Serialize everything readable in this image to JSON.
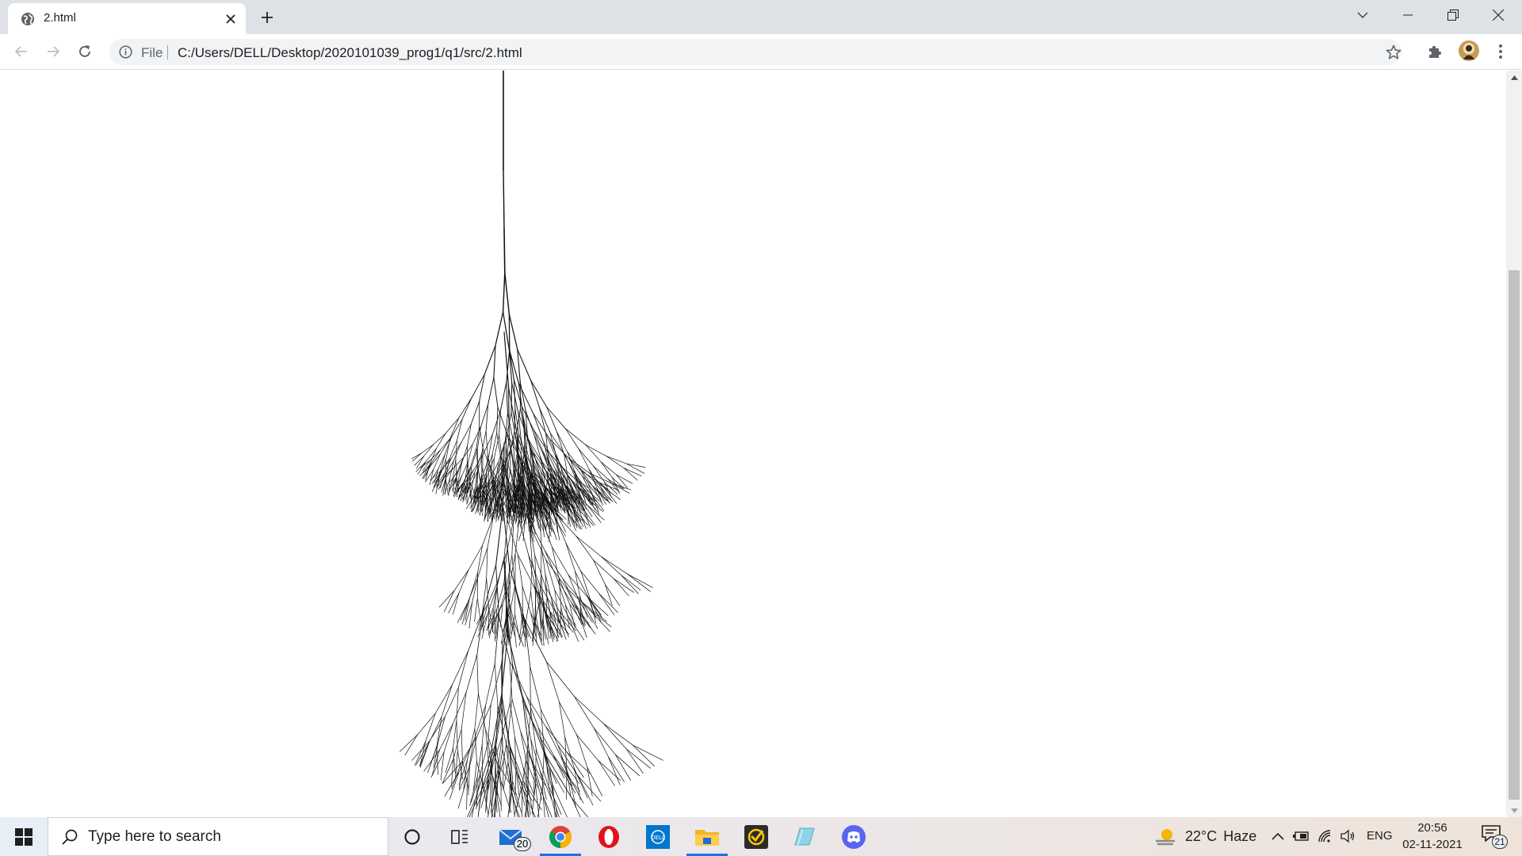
{
  "browser": {
    "tab": {
      "title": "2.html"
    },
    "address_bar": {
      "scheme_label": "File",
      "url": "C:/Users/DELL/Desktop/2020101039_prog1/q1/src/2.html"
    }
  },
  "taskbar": {
    "search_placeholder": "Type here to search",
    "apps": [
      {
        "name": "Cortana",
        "icon": "circle-icon"
      },
      {
        "name": "Task View",
        "icon": "taskview-icon"
      },
      {
        "name": "Mail",
        "icon": "mail-icon",
        "badge": "20"
      },
      {
        "name": "Google Chrome",
        "icon": "chrome-icon",
        "active": true
      },
      {
        "name": "Opera",
        "icon": "opera-icon"
      },
      {
        "name": "Dell",
        "icon": "dell-icon"
      },
      {
        "name": "File Explorer",
        "icon": "folder-icon",
        "active": true
      },
      {
        "name": "Norton",
        "icon": "norton-icon"
      },
      {
        "name": "Notes",
        "icon": "notes-icon"
      },
      {
        "name": "Discord",
        "icon": "discord-icon"
      }
    ],
    "weather": {
      "temperature": "22°C",
      "condition": "Haze"
    },
    "language": "ENG",
    "clock": {
      "time": "20:56",
      "date": "02-11-2021"
    },
    "notification_count": "21"
  },
  "colors": {
    "tab_strip": "#dee1e6",
    "omnibox": "#f1f3f4",
    "drawing": "#111111",
    "chrome_blue": "#1a73e8"
  }
}
